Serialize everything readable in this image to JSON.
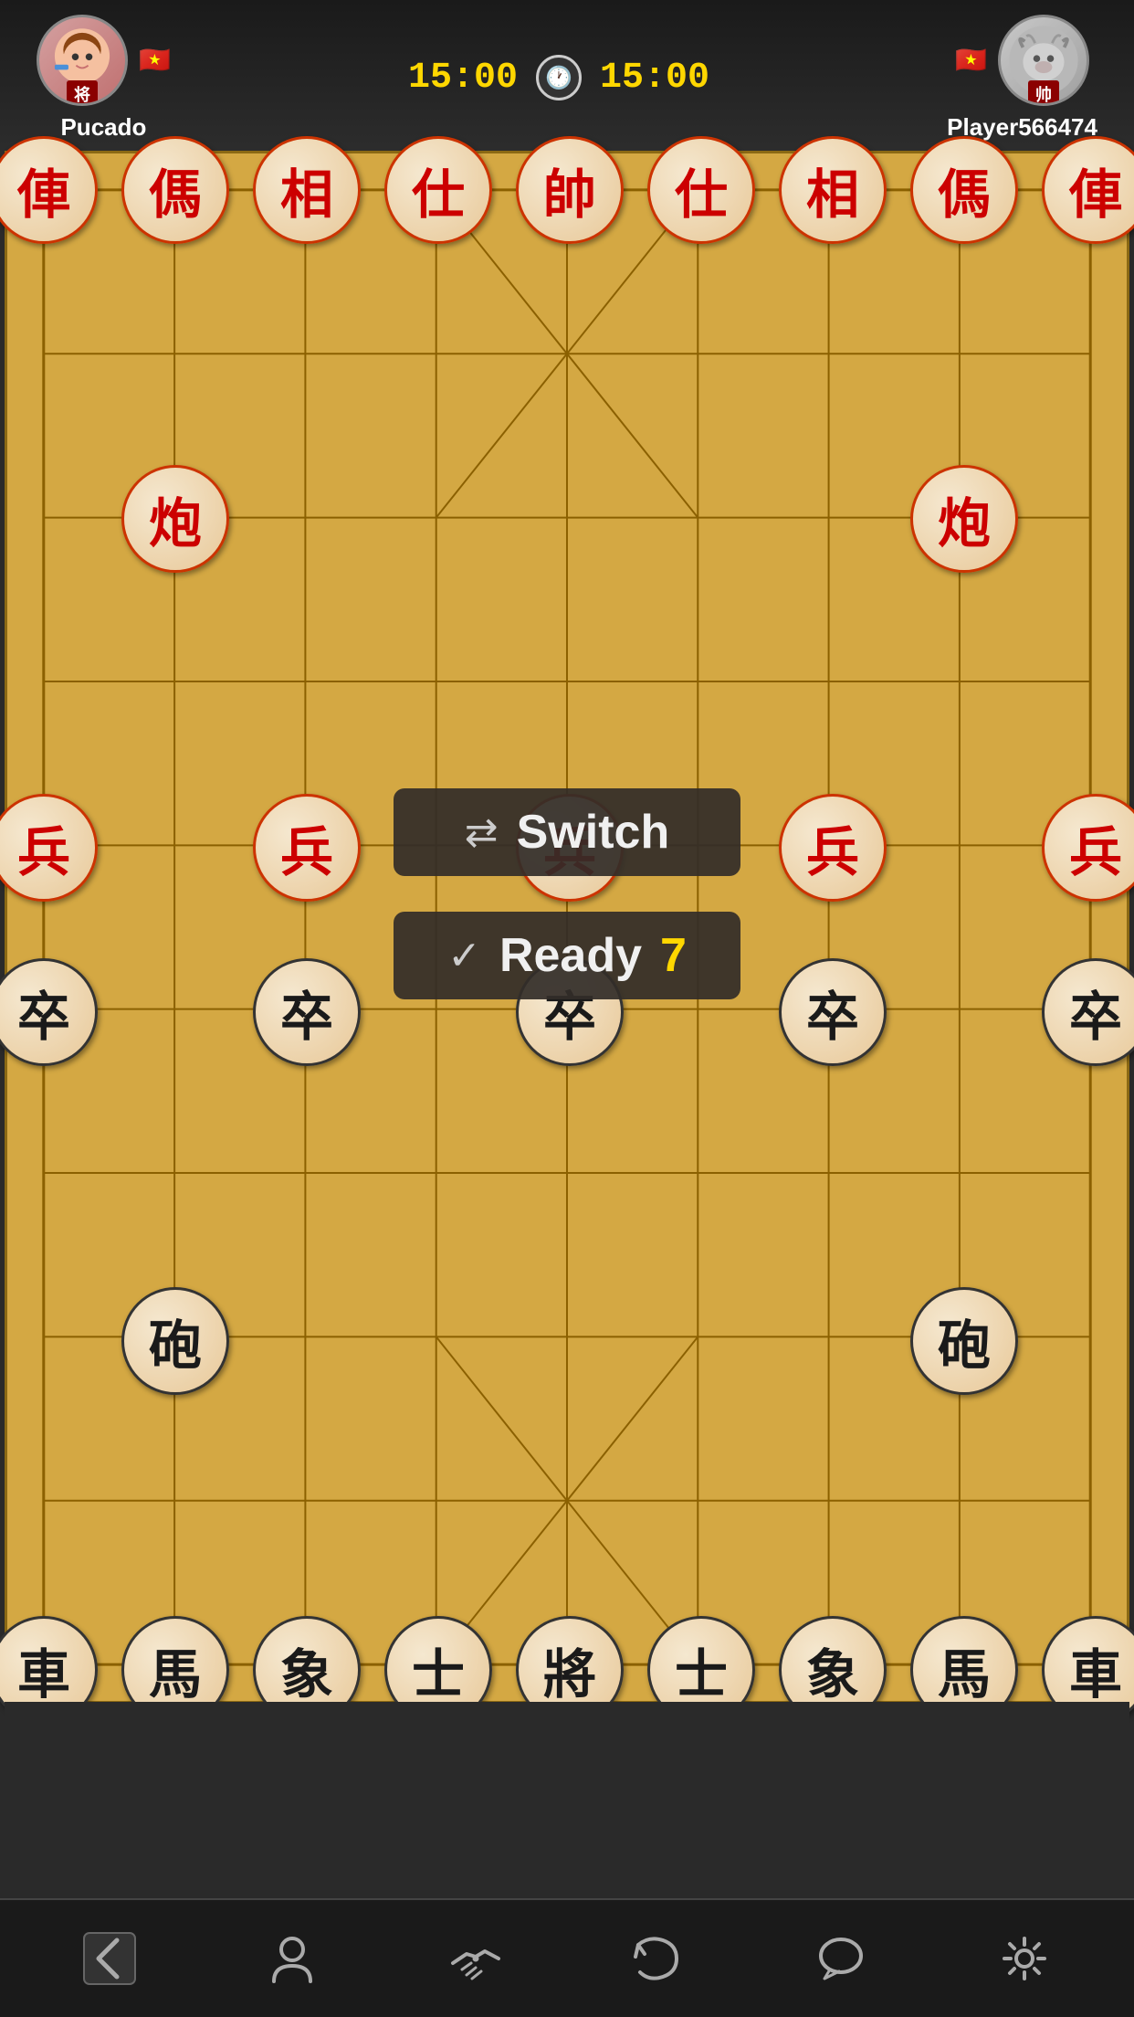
{
  "header": {
    "player1": {
      "name": "Pucado",
      "avatar_type": "female",
      "rank": "将",
      "flag": "🇻🇳",
      "timer": "15:00"
    },
    "player2": {
      "name": "Player566474",
      "avatar_type": "ram",
      "rank": "帅",
      "flag": "🇻🇳",
      "timer": "15:00"
    },
    "clock_symbol": "🕐"
  },
  "board": {
    "cols": 9,
    "rows": 10,
    "red_pieces": [
      {
        "char": "俥",
        "col": 0,
        "row": 0
      },
      {
        "char": "傌",
        "col": 1,
        "row": 0
      },
      {
        "char": "相",
        "col": 2,
        "row": 0
      },
      {
        "char": "仕",
        "col": 3,
        "row": 0
      },
      {
        "char": "帥",
        "col": 4,
        "row": 0
      },
      {
        "char": "仕",
        "col": 5,
        "row": 0
      },
      {
        "char": "相",
        "col": 6,
        "row": 0
      },
      {
        "char": "傌",
        "col": 7,
        "row": 0
      },
      {
        "char": "俥",
        "col": 8,
        "row": 0
      },
      {
        "char": "炮",
        "col": 1,
        "row": 2
      },
      {
        "char": "炮",
        "col": 7,
        "row": 2
      },
      {
        "char": "兵",
        "col": 0,
        "row": 4
      },
      {
        "char": "兵",
        "col": 2,
        "row": 4
      },
      {
        "char": "兵",
        "col": 4,
        "row": 4
      },
      {
        "char": "兵",
        "col": 6,
        "row": 4
      },
      {
        "char": "兵",
        "col": 8,
        "row": 4
      }
    ],
    "black_pieces": [
      {
        "char": "卒",
        "col": 0,
        "row": 5
      },
      {
        "char": "卒",
        "col": 2,
        "row": 5
      },
      {
        "char": "卒",
        "col": 4,
        "row": 5
      },
      {
        "char": "卒",
        "col": 6,
        "row": 5
      },
      {
        "char": "卒",
        "col": 8,
        "row": 5
      },
      {
        "char": "砲",
        "col": 1,
        "row": 7
      },
      {
        "char": "砲",
        "col": 7,
        "row": 7
      },
      {
        "char": "車",
        "col": 0,
        "row": 9
      },
      {
        "char": "馬",
        "col": 1,
        "row": 9
      },
      {
        "char": "象",
        "col": 2,
        "row": 9
      },
      {
        "char": "士",
        "col": 3,
        "row": 9
      },
      {
        "char": "將",
        "col": 4,
        "row": 9
      },
      {
        "char": "士",
        "col": 5,
        "row": 9
      },
      {
        "char": "象",
        "col": 6,
        "row": 9
      },
      {
        "char": "馬",
        "col": 7,
        "row": 9
      },
      {
        "char": "車",
        "col": 8,
        "row": 9
      }
    ]
  },
  "overlay": {
    "switch_label": "Switch",
    "switch_icon": "⇄",
    "ready_label": "Ready",
    "ready_number": "7",
    "ready_icon": "✓"
  },
  "toolbar": {
    "back_icon": "←",
    "player_icon": "person",
    "handshake_icon": "handshake",
    "undo_icon": "undo",
    "chat_icon": "chat",
    "settings_icon": "gear"
  }
}
